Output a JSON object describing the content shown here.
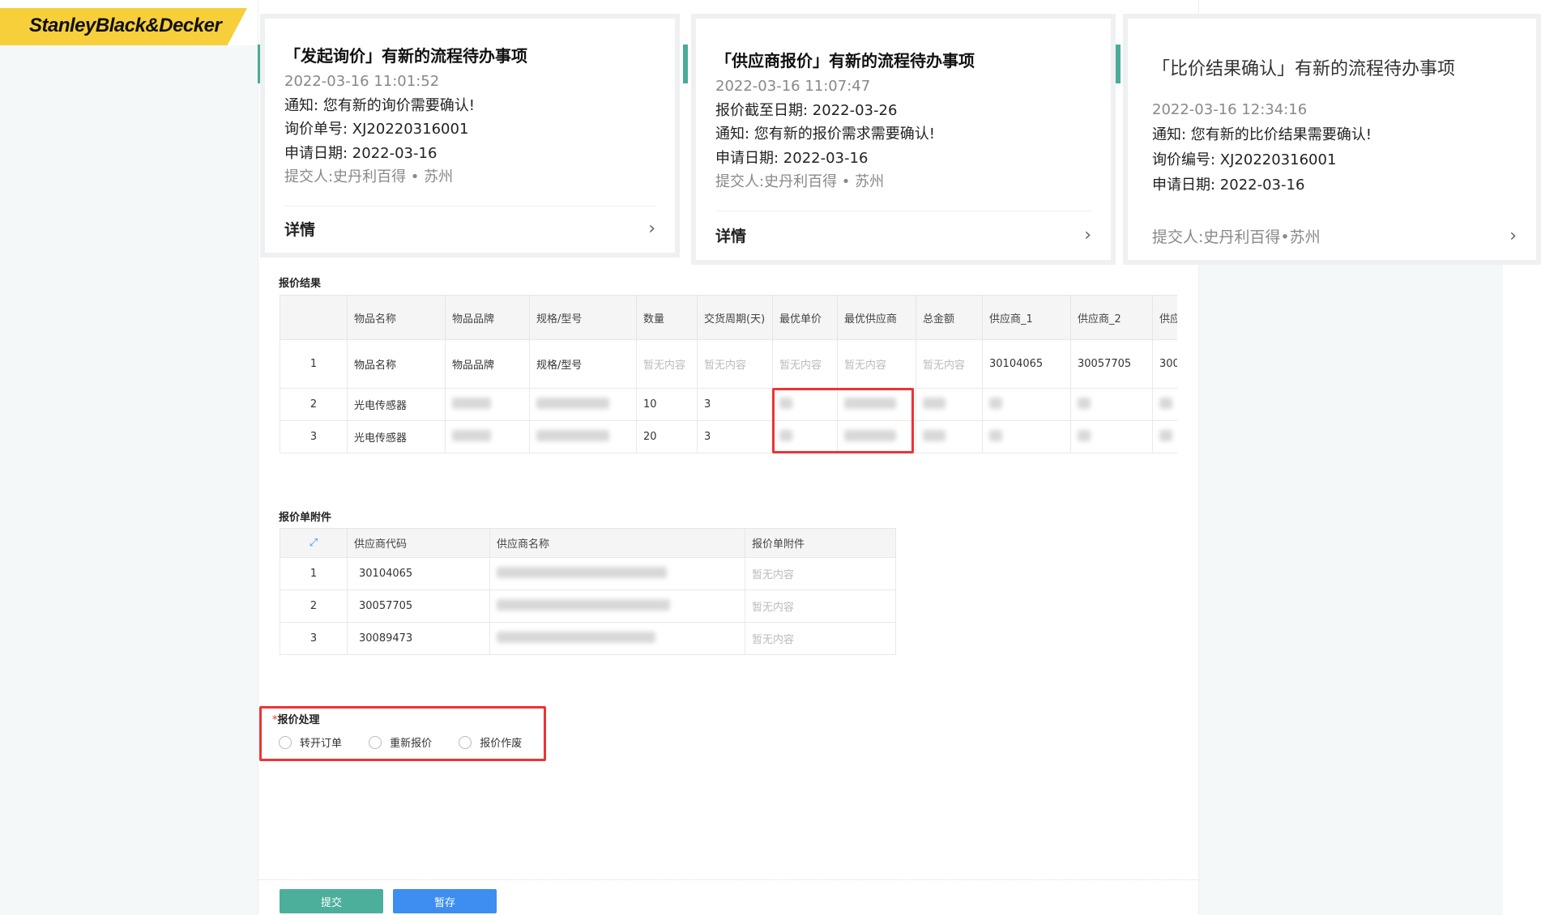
{
  "brand": {
    "logo_text": "StanleyBlack&Decker",
    "accent": "#f6cf3b"
  },
  "cards": [
    {
      "title": "「发起询价」有新的流程待办事项",
      "time": "2022-03-16 11:01:52",
      "lines": [
        "通知: 您有新的询价需要确认!",
        "询价单号: XJ20220316001",
        "申请日期: 2022-03-16"
      ],
      "submitter": "提交人:史丹利百得 • 苏州",
      "detail": "详情"
    },
    {
      "title": "「供应商报价」有新的流程待办事项",
      "time": "2022-03-16 11:07:47",
      "lines": [
        "报价截至日期: 2022-03-26",
        "通知: 您有新的报价需求需要确认!",
        "申请日期: 2022-03-16"
      ],
      "submitter": "提交人:史丹利百得 • 苏州",
      "detail": "详情"
    },
    {
      "title": "「比价结果确认」有新的流程待办事项",
      "time": "2022-03-16 12:34:16",
      "lines": [
        "通知: 您有新的比价结果需要确认!",
        "询价编号: XJ20220316001",
        "申请日期: 2022-03-16"
      ],
      "submitter": "提交人:史丹利百得•苏州"
    }
  ],
  "quote_result": {
    "title": "报价结果",
    "headers": [
      "",
      "物品名称",
      "物品品牌",
      "规格/型号",
      "数量",
      "交货周期(天)",
      "最优单价",
      "最优供应商",
      "总金额",
      "供应商_1",
      "供应商_2",
      "供应"
    ],
    "rows": [
      {
        "idx": "1",
        "name": "物品名称",
        "brand": "物品品牌",
        "spec": "规格/型号",
        "qty": "暂无内容",
        "lead": "暂无内容",
        "price": "暂无内容",
        "supplier": "暂无内容",
        "total": "暂无内容",
        "s1": "30104065",
        "s2": "30057705",
        "s3": "300"
      },
      {
        "idx": "2",
        "name": "光电传感器",
        "qty": "10",
        "lead": "3"
      },
      {
        "idx": "3",
        "name": "光电传感器",
        "qty": "20",
        "lead": "3"
      }
    ]
  },
  "attachments": {
    "title": "报价单附件",
    "headers": [
      "供应商代码",
      "供应商名称",
      "报价单附件"
    ],
    "rows": [
      {
        "idx": "1",
        "code": "30104065",
        "file": "暂无内容"
      },
      {
        "idx": "2",
        "code": "30057705",
        "file": "暂无内容"
      },
      {
        "idx": "3",
        "code": "30089473",
        "file": "暂无内容"
      }
    ]
  },
  "handling": {
    "required_mark": "*",
    "label": "报价处理",
    "options": [
      "转开订单",
      "重新报价",
      "报价作废"
    ]
  },
  "actions": {
    "submit": "提交",
    "save": "暂存",
    "submit_color": "#4caf9b",
    "save_color": "#3d8ef0"
  }
}
